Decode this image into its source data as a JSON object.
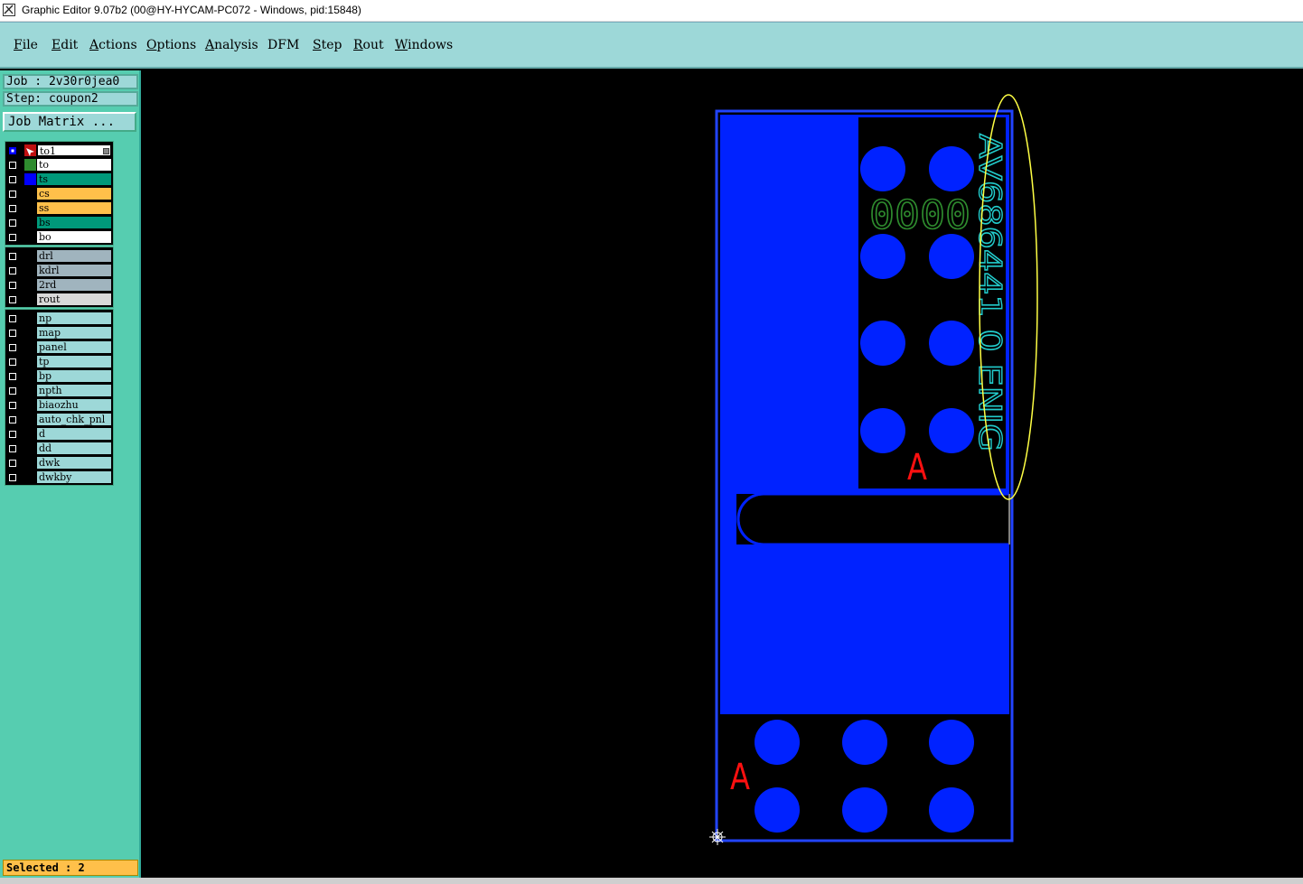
{
  "window": {
    "title": "Graphic Editor 9.07b2 (00@HY-HYCAM-PC072 - Windows, pid:15848)",
    "icon": "graphic-editor-icon"
  },
  "menu": [
    {
      "first": "F",
      "rest": "ile",
      "name": "menu-file"
    },
    {
      "first": "E",
      "rest": "dit",
      "name": "menu-edit"
    },
    {
      "first": "A",
      "rest": "ctions",
      "name": "menu-actions"
    },
    {
      "first": "O",
      "rest": "ptions",
      "name": "menu-options"
    },
    {
      "first": "A",
      "rest": "nalysis",
      "name": "menu-analysis"
    },
    {
      "first": "",
      "rest": "DFM",
      "name": "menu-dfm"
    },
    {
      "first": "S",
      "rest": "tep",
      "name": "menu-step"
    },
    {
      "first": "R",
      "rest": "out",
      "name": "menu-rout"
    },
    {
      "first": "W",
      "rest": "indows",
      "name": "menu-windows"
    }
  ],
  "info": {
    "job": "Job : 2v30r0jea0",
    "step": "Step: coupon2"
  },
  "job_matrix_label": "Job Matrix ...",
  "layer_groups": [
    {
      "rows": [
        {
          "name": "to1",
          "swatch": "#c01010",
          "bg": "#ffffff",
          "active": true,
          "swatch_icon": "pointer-icon"
        },
        {
          "name": "to",
          "swatch": "#2e8b2e",
          "bg": "#ffffff"
        },
        {
          "name": "ts",
          "swatch": "#0000ff",
          "bg": "#00997a"
        },
        {
          "name": "cs",
          "swatch": "#000000",
          "bg": "#ffc04a"
        },
        {
          "name": "ss",
          "swatch": "#000000",
          "bg": "#ffc04a"
        },
        {
          "name": "bs",
          "swatch": "#000000",
          "bg": "#00997a"
        },
        {
          "name": "bo",
          "swatch": "#000000",
          "bg": "#ffffff"
        }
      ]
    },
    {
      "rows": [
        {
          "name": "drl",
          "swatch": "#000000",
          "bg": "#a0b4be"
        },
        {
          "name": "kdrl",
          "swatch": "#000000",
          "bg": "#a0b4be"
        },
        {
          "name": "2rd",
          "swatch": "#000000",
          "bg": "#a0b4be"
        },
        {
          "name": "rout",
          "swatch": "#000000",
          "bg": "#d9d9d9"
        }
      ]
    },
    {
      "rows": [
        {
          "name": "np",
          "swatch": "#000000",
          "bg": "#9dd8d8"
        },
        {
          "name": "map",
          "swatch": "#000000",
          "bg": "#9dd8d8"
        },
        {
          "name": "panel",
          "swatch": "#000000",
          "bg": "#9dd8d8"
        },
        {
          "name": "tp",
          "swatch": "#000000",
          "bg": "#9dd8d8"
        },
        {
          "name": "bp",
          "swatch": "#000000",
          "bg": "#9dd8d8"
        },
        {
          "name": "npth",
          "swatch": "#000000",
          "bg": "#9dd8d8"
        },
        {
          "name": "biaozhu",
          "swatch": "#000000",
          "bg": "#9dd8d8"
        },
        {
          "name": "auto_chk_pnl",
          "swatch": "#000000",
          "bg": "#9dd8d8"
        },
        {
          "name": "d",
          "swatch": "#000000",
          "bg": "#9dd8d8"
        },
        {
          "name": "dd",
          "swatch": "#000000",
          "bg": "#9dd8d8"
        },
        {
          "name": "dwk",
          "swatch": "#000000",
          "bg": "#9dd8d8"
        },
        {
          "name": "dwkby",
          "swatch": "#000000",
          "bg": "#9dd8d8"
        }
      ]
    }
  ],
  "status": "Selected : 2",
  "canvas": {
    "pcb_text": "AV686441 0 ENIG",
    "pad_text": "0000",
    "marker_text": "A",
    "colors": {
      "copper": "#0022ff",
      "outline": "#2244ff",
      "text": "#22cccc",
      "marker": "#ff1010",
      "pad_text": "#2e8b2e",
      "selection": "#ffff44"
    }
  }
}
